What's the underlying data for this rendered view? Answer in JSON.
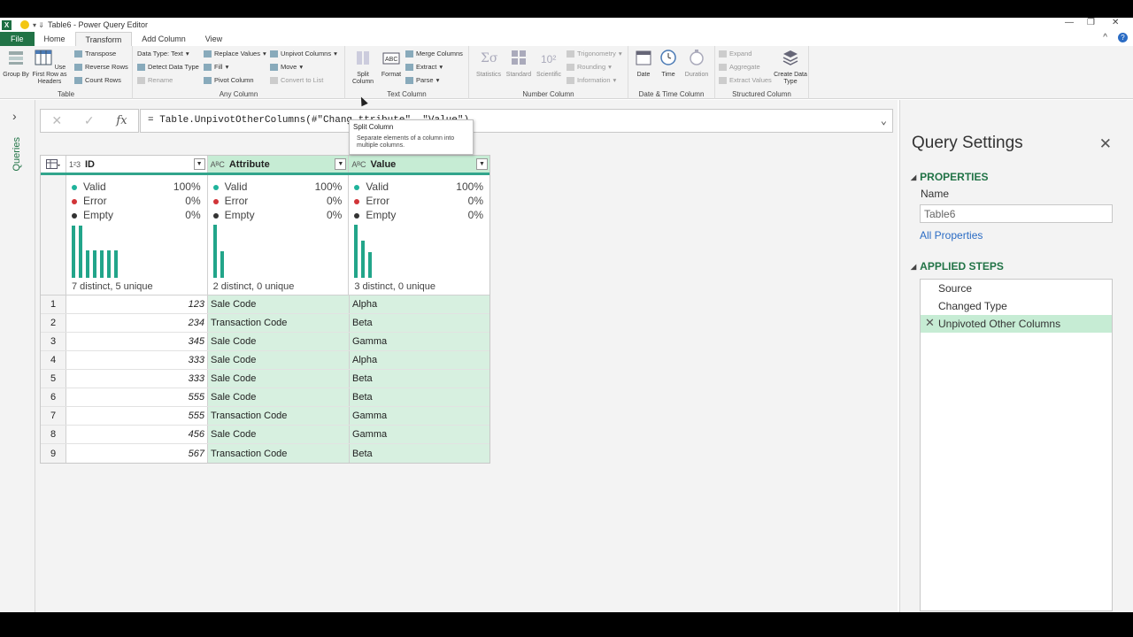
{
  "window": {
    "title": "Table6 - Power Query Editor"
  },
  "ribbon_tabs": [
    "File",
    "Home",
    "Transform",
    "Add Column",
    "View"
  ],
  "ribbon": {
    "table": {
      "label": "Table",
      "group_by": "Group By",
      "use_first_row": "Use First Row as Headers",
      "transpose": "Transpose",
      "reverse_rows": "Reverse Rows",
      "count_rows": "Count Rows"
    },
    "any_column": {
      "label": "Any Column",
      "data_type": "Data Type: Text",
      "detect_data_type": "Detect Data Type",
      "rename": "Rename",
      "replace_values": "Replace Values",
      "fill": "Fill",
      "pivot_column": "Pivot Column",
      "unpivot_columns": "Unpivot Columns",
      "move": "Move",
      "convert_to_list": "Convert to List"
    },
    "text_column": {
      "label": "Text Column",
      "split_column": "Split Column",
      "format": "Format",
      "merge_columns": "Merge Columns",
      "extract": "Extract",
      "parse": "Parse"
    },
    "number_column": {
      "label": "Number Column",
      "statistics": "Statistics",
      "standard": "Standard",
      "scientific": "Scientific",
      "trigonometry": "Trigonometry",
      "rounding": "Rounding",
      "information": "Information"
    },
    "date_time": {
      "label": "Date & Time Column",
      "date": "Date",
      "time": "Time",
      "duration": "Duration"
    },
    "structured": {
      "label": "Structured Column",
      "expand": "Expand",
      "aggregate": "Aggregate",
      "extract_values": "Extract Values",
      "create_data_type": "Create Data Type"
    }
  },
  "tooltip": {
    "title": "Split Column",
    "description": "Separate elements of a column into multiple columns."
  },
  "sidebar": {
    "label": "Queries"
  },
  "formula": "= Table.UnpivotOtherColumns(#\"Chang                       ttribute\", \"Value\")",
  "columns": [
    {
      "name": "ID",
      "type": "1²3",
      "valid": "100%",
      "error": "0%",
      "empty": "0%",
      "distinct": "7 distinct, 5 unique",
      "hist": [
        0.98,
        0.98,
        0.52,
        0.52,
        0.52,
        0.52,
        0.52
      ]
    },
    {
      "name": "Attribute",
      "type": "AᴮC",
      "valid": "100%",
      "error": "0%",
      "empty": "0%",
      "distinct": "2 distinct, 0 unique",
      "hist": [
        1.0,
        0.5
      ]
    },
    {
      "name": "Value",
      "type": "AᴮC",
      "valid": "100%",
      "error": "0%",
      "empty": "0%",
      "distinct": "3 distinct, 0 unique",
      "hist": [
        1.0,
        0.7,
        0.48
      ]
    }
  ],
  "profile_labels": {
    "valid": "Valid",
    "error": "Error",
    "empty": "Empty"
  },
  "rows": [
    {
      "n": "1",
      "id": "123",
      "attribute": "Sale Code",
      "value": "Alpha"
    },
    {
      "n": "2",
      "id": "234",
      "attribute": "Transaction Code",
      "value": "Beta"
    },
    {
      "n": "3",
      "id": "345",
      "attribute": "Sale Code",
      "value": "Gamma"
    },
    {
      "n": "4",
      "id": "333",
      "attribute": "Sale Code",
      "value": "Alpha"
    },
    {
      "n": "5",
      "id": "333",
      "attribute": "Sale Code",
      "value": "Beta"
    },
    {
      "n": "6",
      "id": "555",
      "attribute": "Sale Code",
      "value": "Beta"
    },
    {
      "n": "7",
      "id": "555",
      "attribute": "Transaction Code",
      "value": "Gamma"
    },
    {
      "n": "8",
      "id": "456",
      "attribute": "Sale Code",
      "value": "Gamma"
    },
    {
      "n": "9",
      "id": "567",
      "attribute": "Transaction Code",
      "value": "Beta"
    }
  ],
  "query_settings": {
    "title": "Query Settings",
    "properties_label": "PROPERTIES",
    "name_label": "Name",
    "name_value": "Table6",
    "all_properties": "All Properties",
    "applied_steps_label": "APPLIED STEPS",
    "steps": [
      "Source",
      "Changed Type",
      "Unpivoted Other Columns"
    ]
  },
  "colors": {
    "accent": "#217346",
    "profile_bar": "#22a58a",
    "valid": "#1fb39b",
    "error": "#d13438",
    "empty": "#333333",
    "selected": "#c6ecd4"
  }
}
